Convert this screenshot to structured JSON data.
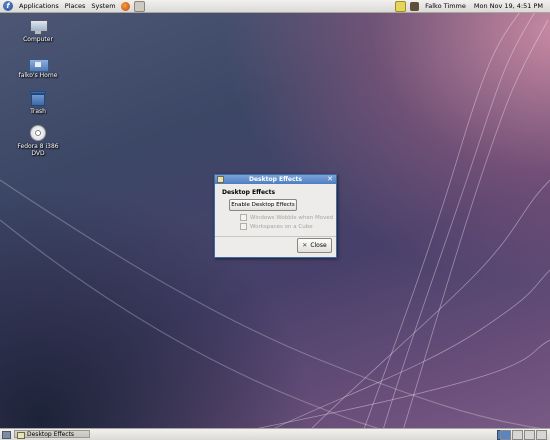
{
  "top_panel": {
    "menus": [
      "Applications",
      "Places",
      "System"
    ],
    "user": "Falko Timme",
    "datetime": "Mon Nov 19,   4:51 PM"
  },
  "desktop_icons": [
    {
      "label": "Computer",
      "icon": "computer-icon"
    },
    {
      "label": "falko's Home",
      "icon": "home-folder-icon"
    },
    {
      "label": "Trash",
      "icon": "trash-icon"
    },
    {
      "label": "Fedora 8 i386 DVD",
      "icon": "dvd-icon"
    }
  ],
  "dialog": {
    "title": "Desktop Effects",
    "heading": "Desktop Effects",
    "enable_button": "Enable Desktop Effects",
    "options": [
      "Windows Wobble when Moved",
      "Workspaces on a Cube"
    ],
    "close_button": "Close"
  },
  "taskbar": {
    "task": "Desktop Effects"
  },
  "colors": {
    "accent": "#4f7ec0",
    "panel": "#e6e4e0"
  }
}
